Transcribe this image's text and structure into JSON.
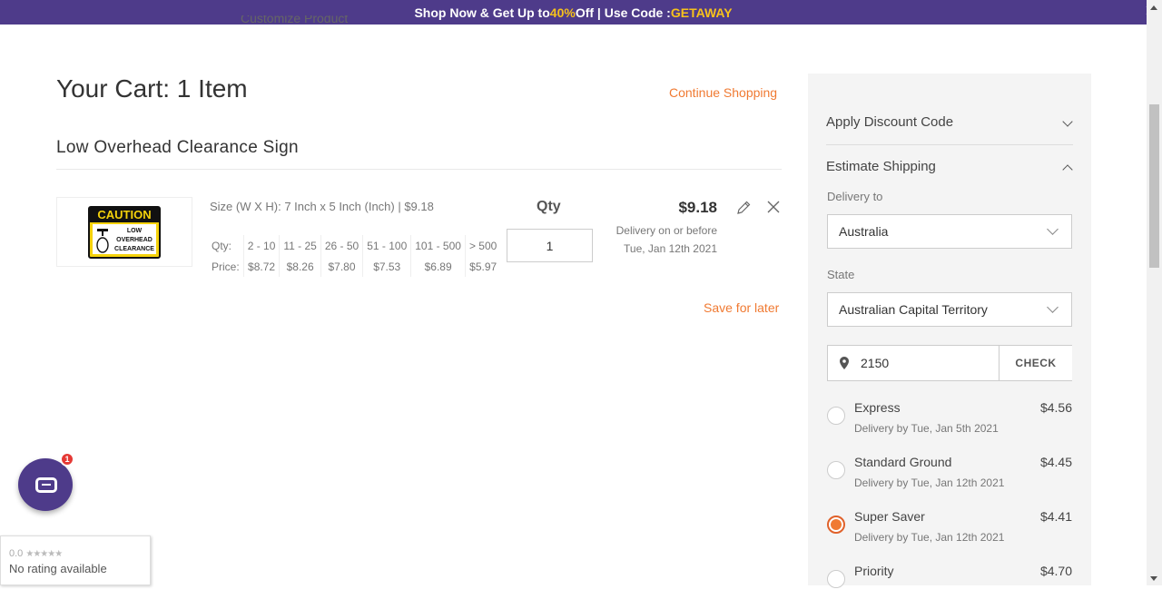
{
  "promo": {
    "prefix": "Shop Now & Get Up to ",
    "percent": "40%",
    "middle": " Off | Use Code : ",
    "code": "GETAWAY",
    "close": "✕"
  },
  "peek_text": "Customize Product",
  "cart": {
    "title": "Your Cart: 1 Item",
    "continue_label": "Continue Shopping",
    "product_name": "Low Overhead Clearance Sign",
    "size_line": "Size (W X H): 7 Inch x 5 Inch (Inch) | $9.18",
    "sign": {
      "header": "CAUTION",
      "line1": "LOW",
      "line2": "OVERHEAD",
      "line3": "CLEARANCE"
    },
    "tier": {
      "qty_label": "Qty:",
      "price_label": "Price:",
      "qty": [
        "2 - 10",
        "11 - 25",
        "26 - 50",
        "51 - 100",
        "101 - 500",
        "> 500"
      ],
      "price": [
        "$8.72",
        "$8.26",
        "$7.80",
        "$7.53",
        "$6.89",
        "$5.97"
      ]
    },
    "qty_header": "Qty",
    "qty_value": "1",
    "price": "$9.18",
    "delivery_line1": "Delivery on or before",
    "delivery_line2": "Tue, Jan 12th 2021",
    "save_later": "Save for later"
  },
  "chat": {
    "badge": "1"
  },
  "rating": {
    "score": "0.0",
    "stars": "★★★★★",
    "note": "No rating available"
  },
  "panel": {
    "discount_label": "Apply Discount Code",
    "shipping_label": "Estimate Shipping",
    "delivery_to_label": "Delivery to",
    "country": "Australia",
    "state_label": "State",
    "state": "Australian Capital Territory",
    "zip": "2150",
    "check_label": "CHECK",
    "options": [
      {
        "name": "Express",
        "price": "$4.56",
        "delivery": "Delivery by Tue, Jan 5th 2021",
        "selected": false
      },
      {
        "name": "Standard Ground",
        "price": "$4.45",
        "delivery": "Delivery by Tue, Jan 12th 2021",
        "selected": false
      },
      {
        "name": "Super Saver",
        "price": "$4.41",
        "delivery": "Delivery by Tue, Jan 12th 2021",
        "selected": true
      },
      {
        "name": "Priority",
        "price": "$4.70",
        "delivery": "",
        "selected": false
      }
    ]
  },
  "colors": {
    "brand": "#4e3b8a",
    "accent": "#f07a32",
    "promo_highlight": "#f7c21b"
  }
}
